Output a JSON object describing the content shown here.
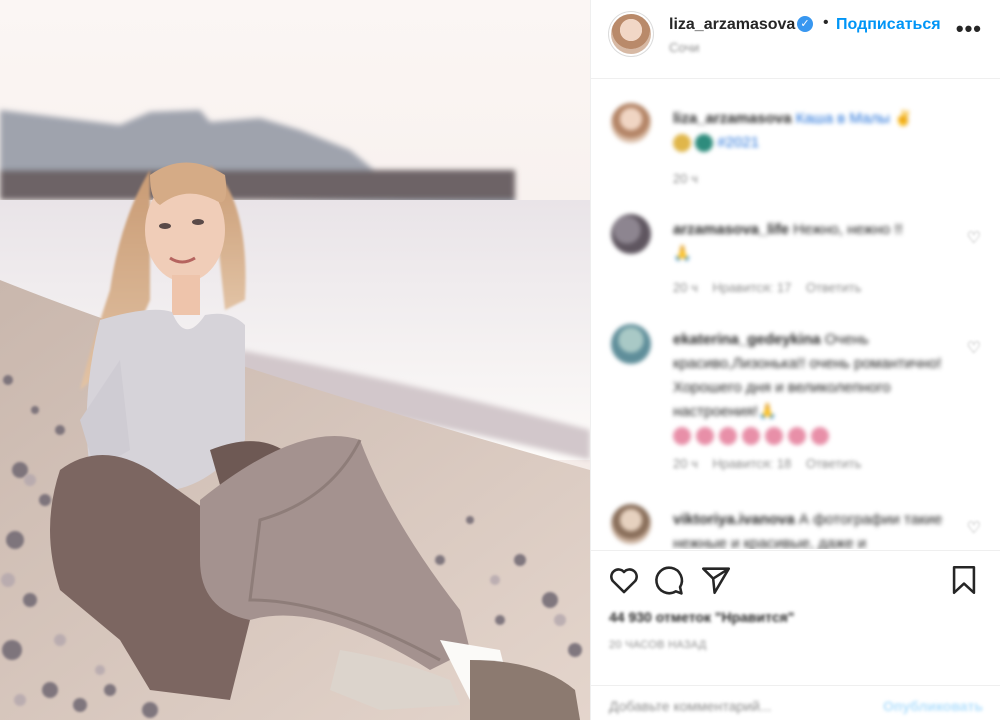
{
  "post": {
    "username": "liza_arzamasova",
    "follow_label": "Подписаться",
    "separator": "•",
    "location": "Сочи",
    "more_label": "•••"
  },
  "comments": [
    {
      "user": "liza_arzamasova",
      "text": " Каша в Малы ✌",
      "line2": " #2021",
      "time": "20 ч"
    },
    {
      "user": "arzamasova_life",
      "text": " Нежно, нежно !!",
      "line2": "🙏",
      "time": "20 ч",
      "likes": "Нравится: 17",
      "reply": "Ответить"
    },
    {
      "user": "ekaterina_gedeykina",
      "text": " Очень красиво,Лизонька!! очень романтично!Хорошего дня и великолепного настроения!🙏",
      "time": "20 ч",
      "likes": "Нравится: 18",
      "reply": "Ответить"
    },
    {
      "user": "viktoriya.ivanova",
      "text": " А фотографии такие нежные и красивые, даже и"
    }
  ],
  "actions": {
    "likes_text": "44 930 отметок \"Нравится\"",
    "time_ago": "20 ЧАСОВ НАЗАД",
    "comment_placeholder": "Добавьте комментарий...",
    "publish_label": "Опубликовать"
  },
  "colors": {
    "link_blue": "#0095f6",
    "verified_blue": "#3897f0",
    "muted": "#8e8e8e"
  },
  "icons": [
    "verified-badge-icon",
    "heart-icon",
    "comment-icon",
    "share-icon",
    "bookmark-icon",
    "more-icon"
  ]
}
